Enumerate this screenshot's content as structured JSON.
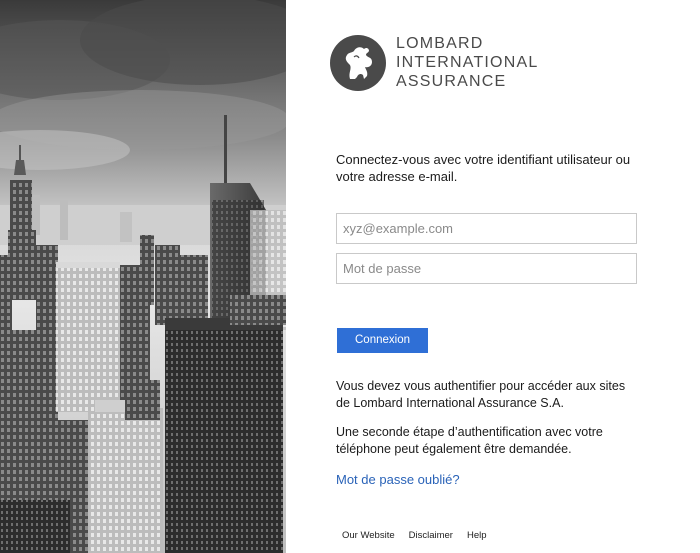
{
  "brand": {
    "line1": "LOMBARD",
    "line2": "INTERNATIONAL",
    "line3": "ASSURANCE",
    "logo_icon": "lion-rampant-icon",
    "logo_color": "#4a4a4a"
  },
  "login": {
    "intro": "Connectez-vous avec votre identifiant utilisateur ou votre adresse e-mail.",
    "email_placeholder": "xyz@example.com",
    "password_placeholder": "Mot de passe",
    "submit_label": "Connexion",
    "submit_color": "#2f6fd6",
    "notice_1": "Vous devez vous authentifier pour accéder aux sites de Lombard International Assurance S.A.",
    "notice_2": "Une seconde étape d’authentification avec votre téléphone peut également être demandée.",
    "forgot_password": "Mot de passe oublié?",
    "link_color": "#2a63b8"
  },
  "footer": {
    "links": [
      "Our Website",
      "Disclaimer",
      "Help"
    ]
  }
}
